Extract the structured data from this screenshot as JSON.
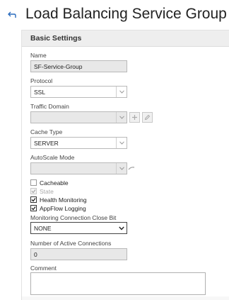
{
  "page": {
    "title": "Load Balancing Service Group"
  },
  "panel": {
    "header": "Basic Settings"
  },
  "form": {
    "name_label": "Name",
    "name_value": "SF-Service-Group",
    "protocol_label": "Protocol",
    "protocol_value": "SSL",
    "traffic_domain_label": "Traffic Domain",
    "traffic_domain_value": "",
    "cache_type_label": "Cache Type",
    "cache_type_value": "SERVER",
    "autoscale_label": "AutoScale Mode",
    "autoscale_value": "",
    "cacheable_label": "Cacheable",
    "cacheable_checked": false,
    "state_label": "State",
    "state_checked": true,
    "health_monitoring_label": "Health Monitoring",
    "health_monitoring_checked": true,
    "appflow_logging_label": "AppFlow Logging",
    "appflow_logging_checked": true,
    "monitoring_close_bit_label": "Monitoring Connection Close Bit",
    "monitoring_close_bit_value": "NONE",
    "active_connections_label": "Number of Active Connections",
    "active_connections_value": "0",
    "comment_label": "Comment",
    "comment_value": ""
  },
  "icons": {
    "back": "back-arrow-icon",
    "add": "plus-icon",
    "edit": "pencil-icon",
    "dropdown": "chevron-down-icon",
    "loading": "spinner-icon",
    "check": "checkmark-icon"
  },
  "colors": {
    "accent": "#2a6bbd",
    "panel_header_bg": "#eeeeee",
    "field_bg": "#e8e8e8"
  }
}
